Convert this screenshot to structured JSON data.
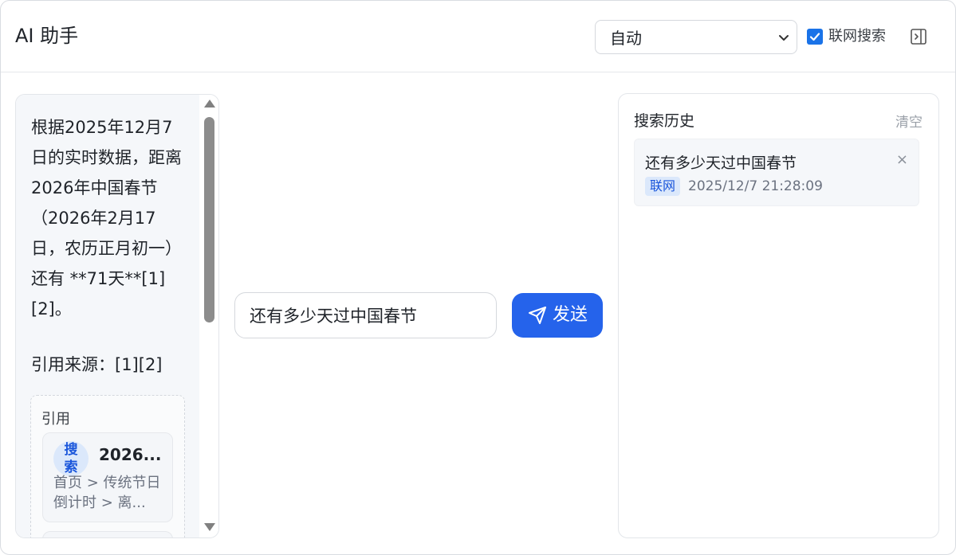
{
  "header": {
    "title": "AI 助手",
    "model_select_value": "自动",
    "web_search_label": "联网搜索",
    "web_search_checked": true
  },
  "chat": {
    "answer": "根据2025年12月7日的实时数据，距离2026年中国春节（2026年2月17日，农历正月初一）还有 **71天**[1][2]。",
    "sources_line": "引用来源：[1][2]",
    "citations_label": "引用",
    "citations": [
      {
        "badge": "搜索",
        "title": "2026...",
        "path": "首页 > 传统节日倒计时 > 离..."
      }
    ]
  },
  "input": {
    "value": "还有多少天过中国春节",
    "send_label": "发送"
  },
  "history": {
    "title": "搜索历史",
    "clear_label": "清空",
    "items": [
      {
        "query": "还有多少天过中国春节",
        "tag": "联网",
        "time": "2025/12/7 21:28:09",
        "close": "×"
      }
    ]
  },
  "colors": {
    "accent": "#2563eb",
    "checkbox": "#1a73e8",
    "tag_bg": "#dbe8fb",
    "tag_text": "#1a56db"
  }
}
